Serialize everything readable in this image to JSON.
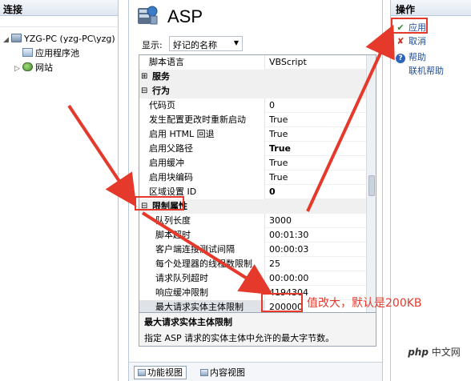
{
  "left_pane": {
    "header": "连接",
    "tree": [
      {
        "label": "YZG-PC (yzg-PC\\yzg)",
        "expander": "◢"
      },
      {
        "label": "应用程序池",
        "expander": ""
      },
      {
        "label": "网站",
        "expander": "▷"
      }
    ]
  },
  "main": {
    "title": "ASP",
    "display_label": "显示:",
    "display_value": "好记的名称",
    "properties": [
      {
        "name": "脚本语言",
        "value": "VBScript",
        "kind": "prop"
      },
      {
        "name": "服务",
        "value": "",
        "kind": "cat",
        "expander": "⊞"
      },
      {
        "name": "行为",
        "value": "",
        "kind": "cat",
        "expander": "⊟"
      },
      {
        "name": "代码页",
        "value": "0",
        "kind": "prop"
      },
      {
        "name": "发生配置更改时重新启动",
        "value": "True",
        "kind": "prop"
      },
      {
        "name": "启用 HTML 回退",
        "value": "True",
        "kind": "prop"
      },
      {
        "name": "启用父路径",
        "value": "True",
        "kind": "prop",
        "bold": true
      },
      {
        "name": "启用缓冲",
        "value": "True",
        "kind": "prop"
      },
      {
        "name": "启用块编码",
        "value": "True",
        "kind": "prop"
      },
      {
        "name": "区域设置 ID",
        "value": "0",
        "kind": "prop",
        "bold": true
      },
      {
        "name": "限制属性",
        "value": "",
        "kind": "cat",
        "expander": "⊟"
      },
      {
        "name": "队列长度",
        "value": "3000",
        "kind": "sub"
      },
      {
        "name": "脚本超时",
        "value": "00:01:30",
        "kind": "sub"
      },
      {
        "name": "客户端连接测试间隔",
        "value": "00:00:03",
        "kind": "sub"
      },
      {
        "name": "每个处理器的线程数限制",
        "value": "25",
        "kind": "sub"
      },
      {
        "name": "请求队列超时",
        "value": "00:00:00",
        "kind": "sub"
      },
      {
        "name": "响应缓冲限制",
        "value": "4194304",
        "kind": "sub"
      },
      {
        "name": "最大请求实体主体限制",
        "value": "200000",
        "kind": "sub",
        "selected": true
      }
    ],
    "description": {
      "title": "最大请求实体主体限制",
      "text": "指定 ASP 请求的实体主体中允许的最大字节数。"
    },
    "tabs": [
      {
        "label": "功能视图",
        "active": true
      },
      {
        "label": "内容视图",
        "active": false
      }
    ]
  },
  "right_pane": {
    "header": "操作",
    "actions": [
      {
        "label": "应用",
        "icon": "apply-icon"
      },
      {
        "label": "取消",
        "icon": "cancel-icon"
      },
      {
        "label": "帮助",
        "icon": "help-icon"
      },
      {
        "label": "联机帮助",
        "icon": ""
      }
    ]
  },
  "annotation": {
    "text": "值改大，默认是200KB",
    "color": "#e53a2b"
  },
  "watermark": {
    "brand": "php",
    "site": "中文网"
  }
}
